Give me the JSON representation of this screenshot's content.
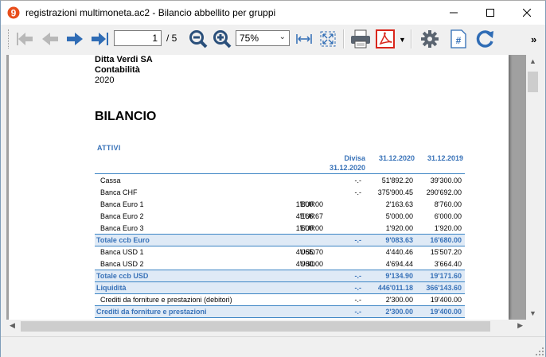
{
  "window": {
    "title": "registrazioni multimoneta.ac2 - Bilancio abbellito per gruppi",
    "app_icon": "banana-9-icon"
  },
  "toolbar": {
    "page_current": "1",
    "page_total": "/ 5",
    "zoom_value": "75%",
    "overflow_label": "»",
    "icons": [
      "first-page-icon",
      "previous-page-icon",
      "next-page-icon",
      "last-page-icon",
      "zoom-out-icon",
      "zoom-in-icon",
      "fit-width-icon",
      "fit-page-icon",
      "print-icon",
      "pdf-icon",
      "settings-icon",
      "page-number-icon",
      "refresh-icon"
    ]
  },
  "report": {
    "company": "Ditta Verdi SA",
    "dept": "Contabilità",
    "year": "2020",
    "title": "BILANCIO",
    "section": "ATTIVI",
    "col_divisa_1": "Divisa",
    "col_divisa_2": "31.12.2020",
    "col_2020": "31.12.2020",
    "col_2019": "31.12.2019",
    "rows": [
      {
        "label": "Cassa",
        "cur": "",
        "amount": "",
        "divisa": "-.-",
        "v2020": "51'892.20",
        "v2019": "39'300.00",
        "total": false
      },
      {
        "label": "Banca CHF",
        "cur": "",
        "amount": "",
        "divisa": "-.-",
        "v2020": "375'900.45",
        "v2019": "290'692.00",
        "total": false
      },
      {
        "label": "Banca Euro 1",
        "cur": "EUR",
        "amount": "1'800.00",
        "divisa": "",
        "v2020": "2'163.63",
        "v2019": "8'760.00",
        "total": false
      },
      {
        "label": "Banca Euro 2",
        "cur": "EUR",
        "amount": "4'166.67",
        "divisa": "",
        "v2020": "5'000.00",
        "v2019": "6'000.00",
        "total": false
      },
      {
        "label": "Banca Euro 3",
        "cur": "EUR",
        "amount": "1'600.00",
        "divisa": "",
        "v2020": "1'920.00",
        "v2019": "1'920.00",
        "total": false
      },
      {
        "label": "Totale ccb Euro",
        "cur": "",
        "amount": "",
        "divisa": "-.-",
        "v2020": "9'083.63",
        "v2019": "16'680.00",
        "total": true
      },
      {
        "label": "Banca USD 1",
        "cur": "USD",
        "amount": "4'065.70",
        "divisa": "",
        "v2020": "4'440.46",
        "v2019": "15'507.20",
        "total": false
      },
      {
        "label": "Banca USD 2",
        "cur": "USD",
        "amount": "4'900.00",
        "divisa": "",
        "v2020": "4'694.44",
        "v2019": "3'664.40",
        "total": false
      },
      {
        "label": "Totale ccb USD",
        "cur": "",
        "amount": "",
        "divisa": "-.-",
        "v2020": "9'134.90",
        "v2019": "19'171.60",
        "total": true
      },
      {
        "label": "Liquidità",
        "cur": "",
        "amount": "",
        "divisa": "-.-",
        "v2020": "446'011.18",
        "v2019": "366'143.60",
        "total": true
      },
      {
        "label": "Crediti da forniture e prestazioni (debitori)",
        "cur": "",
        "amount": "",
        "divisa": "-.-",
        "v2020": "2'300.00",
        "v2019": "19'400.00",
        "total": false
      },
      {
        "label": "Crediti da forniture e prestazioni",
        "cur": "",
        "amount": "",
        "divisa": "-.-",
        "v2020": "2'300.00",
        "v2019": "19'400.00",
        "total": true
      }
    ]
  },
  "colors": {
    "accent_blue": "#3872b8",
    "total_bg": "#dfeaf6",
    "nav_arrow": "#2f6cb5",
    "pdf_red": "#d9261c"
  }
}
